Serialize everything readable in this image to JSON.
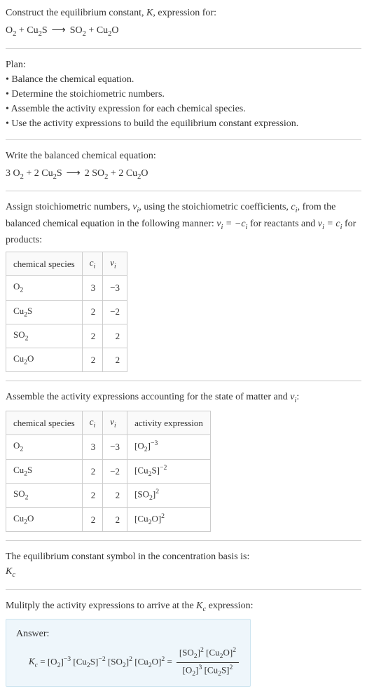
{
  "prompt": {
    "line1": "Construct the equilibrium constant, K, expression for:",
    "reactant1": "O",
    "reactant1_sub": "2",
    "plus1": " + ",
    "reactant2a": "Cu",
    "reactant2a_sub": "2",
    "reactant2b": "S",
    "product1a": "SO",
    "product1a_sub": "2",
    "plus2": " + ",
    "product2a": "Cu",
    "product2a_sub": "2",
    "product2b": "O"
  },
  "plan": {
    "heading": "Plan:",
    "b1": "• Balance the chemical equation.",
    "b2": "• Determine the stoichiometric numbers.",
    "b3": "• Assemble the activity expression for each chemical species.",
    "b4": "• Use the activity expressions to build the equilibrium constant expression."
  },
  "balanced": {
    "heading": "Write the balanced chemical equation:",
    "c1": "3 ",
    "r1": "O",
    "r1sub": "2",
    "plus1": " + ",
    "c2": "2 ",
    "r2a": "Cu",
    "r2asub": "2",
    "r2b": "S",
    "c3": "2 ",
    "p1": "SO",
    "p1sub": "2",
    "plus2": " + ",
    "c4": "2 ",
    "p2a": "Cu",
    "p2asub": "2",
    "p2b": "O"
  },
  "assign": {
    "text_a": "Assign stoichiometric numbers, ",
    "nu": "ν",
    "nu_sub": "i",
    "text_b": ", using the stoichiometric coefficients, ",
    "c": "c",
    "c_sub": "i",
    "text_c": ", from the balanced chemical equation in the following manner: ",
    "eq1_lhs": "ν",
    "eq1_lhs_sub": "i",
    "eq1_eq": " = −",
    "eq1_rhs": "c",
    "eq1_rhs_sub": "i",
    "text_d": " for reactants and ",
    "eq2_lhs": "ν",
    "eq2_lhs_sub": "i",
    "eq2_eq": " = ",
    "eq2_rhs": "c",
    "eq2_rhs_sub": "i",
    "text_e": " for products:"
  },
  "table1": {
    "h1": "chemical species",
    "h2": "c",
    "h2sub": "i",
    "h3": "ν",
    "h3sub": "i",
    "rows": [
      {
        "sp_a": "O",
        "sp_asub": "2",
        "sp_b": "",
        "ci": "3",
        "ni": "−3"
      },
      {
        "sp_a": "Cu",
        "sp_asub": "2",
        "sp_b": "S",
        "ci": "2",
        "ni": "−2"
      },
      {
        "sp_a": "SO",
        "sp_asub": "2",
        "sp_b": "",
        "ci": "2",
        "ni": "2"
      },
      {
        "sp_a": "Cu",
        "sp_asub": "2",
        "sp_b": "O",
        "ci": "2",
        "ni": "2"
      }
    ]
  },
  "assemble": {
    "text_a": "Assemble the activity expressions accounting for the state of matter and ",
    "nu": "ν",
    "nu_sub": "i",
    "text_b": ":"
  },
  "table2": {
    "h1": "chemical species",
    "h2": "c",
    "h2sub": "i",
    "h3": "ν",
    "h3sub": "i",
    "h4": "activity expression",
    "rows": [
      {
        "sp_a": "O",
        "sp_asub": "2",
        "sp_b": "",
        "ci": "3",
        "ni": "−3",
        "ae_a": "[O",
        "ae_asub": "2",
        "ae_b": "]",
        "ae_sup": "−3"
      },
      {
        "sp_a": "Cu",
        "sp_asub": "2",
        "sp_b": "S",
        "ci": "2",
        "ni": "−2",
        "ae_a": "[Cu",
        "ae_asub": "2",
        "ae_b": "S]",
        "ae_sup": "−2"
      },
      {
        "sp_a": "SO",
        "sp_asub": "2",
        "sp_b": "",
        "ci": "2",
        "ni": "2",
        "ae_a": "[SO",
        "ae_asub": "2",
        "ae_b": "]",
        "ae_sup": "2"
      },
      {
        "sp_a": "Cu",
        "sp_asub": "2",
        "sp_b": "O",
        "ci": "2",
        "ni": "2",
        "ae_a": "[Cu",
        "ae_asub": "2",
        "ae_b": "O]",
        "ae_sup": "2"
      }
    ]
  },
  "ksymbol": {
    "text": "The equilibrium constant symbol in the concentration basis is:",
    "K": "K",
    "Ksub": "c"
  },
  "multiply": {
    "text_a": "Mulitply the activity expressions to arrive at the ",
    "K": "K",
    "Ksub": "c",
    "text_b": " expression:"
  },
  "answer": {
    "label": "Answer:",
    "K": "K",
    "Ksub": "c",
    "eq": " = ",
    "t1a": "[O",
    "t1asub": "2",
    "t1b": "]",
    "t1sup": "−3",
    "sp1": " ",
    "t2a": "[Cu",
    "t2asub": "2",
    "t2b": "S]",
    "t2sup": "−2",
    "sp2": " ",
    "t3a": "[SO",
    "t3asub": "2",
    "t3b": "]",
    "t3sup": "2",
    "sp3": " ",
    "t4a": "[Cu",
    "t4asub": "2",
    "t4b": "O]",
    "t4sup": "2",
    "eq2": " = ",
    "num_a": "[SO",
    "num_asub": "2",
    "num_b": "]",
    "num_sup": "2",
    "numsp": " ",
    "num_c": "[Cu",
    "num_csub": "2",
    "num_d": "O]",
    "num_dsup": "2",
    "den_a": "[O",
    "den_asub": "2",
    "den_b": "]",
    "den_sup": "3",
    "densp": " ",
    "den_c": "[Cu",
    "den_csub": "2",
    "den_d": "S]",
    "den_dsup": "2"
  },
  "arrow_glyph": "⟶"
}
